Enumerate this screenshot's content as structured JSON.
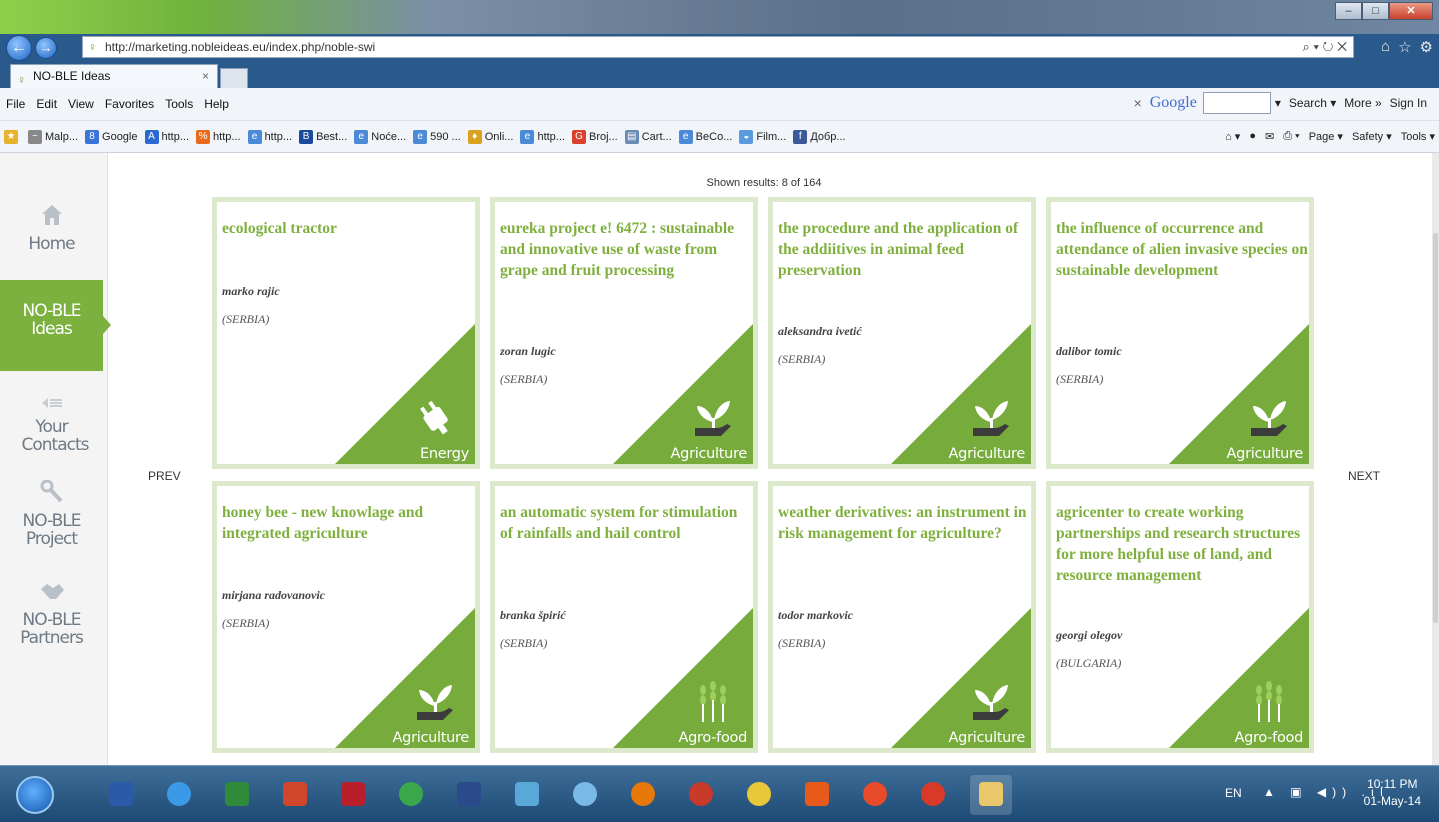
{
  "browser": {
    "url": "http://marketing.nobleideas.eu/index.php/noble-swi",
    "tab_title": "NO-BLE Ideas",
    "menu": [
      "File",
      "Edit",
      "View",
      "Favorites",
      "Tools",
      "Help"
    ],
    "google_bar": {
      "close": "×",
      "brand": "Google",
      "search": "Search ▾",
      "more": "More »",
      "signin": "Sign In"
    },
    "favorites": [
      "Malp...",
      "Google",
      "http...",
      "http...",
      "http...",
      "Best...",
      "Noće...",
      "590 ...",
      "Onli...",
      "http...",
      "Broj...",
      "Cart...",
      "BeCo...",
      "Film...",
      "Добр..."
    ],
    "command_bar": [
      "Page ▾",
      "Safety ▾",
      "Tools ▾"
    ]
  },
  "sidebar": {
    "items": [
      {
        "label": "Home",
        "icon": "home-icon"
      },
      {
        "label": "NO-BLE Ideas",
        "icon": "",
        "active": true
      },
      {
        "label": "Your Contacts",
        "icon": "contacts-icon"
      },
      {
        "label": "NO-BLE Project",
        "icon": "wrench-icon"
      },
      {
        "label": "NO-BLE Partners",
        "icon": "handshake-icon"
      }
    ]
  },
  "results": {
    "shown": "Shown results: 8 of 164"
  },
  "pager": {
    "prev": "PREV",
    "next": "NEXT"
  },
  "cards": [
    {
      "title": "ecological tractor",
      "author": "marko rajic",
      "country": "(SERBIA)",
      "category": "Energy",
      "icon": "plug-icon"
    },
    {
      "title": "eureka project e! 6472 : sustainable and innovative use of waste from grape and fruit processing",
      "author": "zoran lugic",
      "country": "(SERBIA)",
      "category": "Agriculture",
      "icon": "sprout-hand-icon"
    },
    {
      "title": "the procedure and the application of the addiitives in animal feed preservation",
      "author": "aleksandra ivetić",
      "country": "(SERBIA)",
      "category": "Agriculture",
      "icon": "sprout-hand-icon"
    },
    {
      "title": "the influence of occurrence and attendance of alien invasive species on sustainable development",
      "author": "dalibor tomic",
      "country": "(SERBIA)",
      "category": "Agriculture",
      "icon": "sprout-hand-icon"
    },
    {
      "title": "honey bee - new knowlage and integrated agriculture",
      "author": "mirjana radovanovic",
      "country": "(SERBIA)",
      "category": "Agriculture",
      "icon": "sprout-hand-icon"
    },
    {
      "title": "an automatic system for stimulation of rainfalls and hail control",
      "author": "branka špirić",
      "country": "(SERBIA)",
      "category": "Agro-food",
      "icon": "wheat-icon"
    },
    {
      "title": "weather derivatives: an instrument in risk management for agriculture?",
      "author": "todor markovic",
      "country": "(SERBIA)",
      "category": "Agriculture",
      "icon": "sprout-hand-icon"
    },
    {
      "title": "agricenter to create working partnerships and research structures for more helpful use of land, and resource management",
      "author": "georgi olegov",
      "country": "(BULGARIA)",
      "category": "Agro-food",
      "icon": "wheat-icon"
    }
  ],
  "colors": {
    "accent": "#77ac3c",
    "title_green": "#7fb03e",
    "card_border": "#dde9cc"
  },
  "taskbar": {
    "apps": [
      "word-icon",
      "ie-icon",
      "excel-icon",
      "powerpoint-icon",
      "acrobat-icon",
      "utorrent-icon",
      "floppy-icon",
      "network-icon",
      "help-icon",
      "app-icon",
      "app2-icon",
      "chrome-like-icon",
      "media-icon",
      "chrome-icon",
      "fire-icon",
      "explorer-icon"
    ],
    "language": "EN",
    "time": "10:11 PM",
    "date": "01-May-14"
  }
}
